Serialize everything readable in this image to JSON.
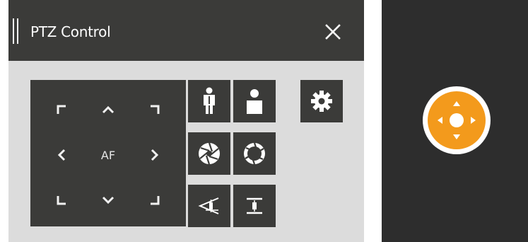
{
  "window": {
    "title": "PTZ Control",
    "close_icon": "close-icon",
    "drag_icon": "drag-handle-icon"
  },
  "dpad": {
    "center_label": "AF",
    "buttons": [
      "up-left",
      "up",
      "up-right",
      "left",
      "right",
      "down-left",
      "down",
      "down-right"
    ]
  },
  "controls": {
    "zoom_in_icon": "person-zoom-in-icon",
    "zoom_out_icon": "person-zoom-out-icon",
    "iris_open_icon": "aperture-open-icon",
    "iris_close_icon": "aperture-close-icon",
    "focus_near_icon": "focus-near-icon",
    "focus_far_icon": "focus-far-icon",
    "settings_icon": "gear-icon"
  },
  "preview": {
    "joystick_icon": "ptz-joystick-icon"
  },
  "colors": {
    "panel_dark": "#3b3b39",
    "panel_light": "#dcdcdc",
    "accent": "#f39a1c",
    "preview_bg": "#2d2d2d"
  }
}
